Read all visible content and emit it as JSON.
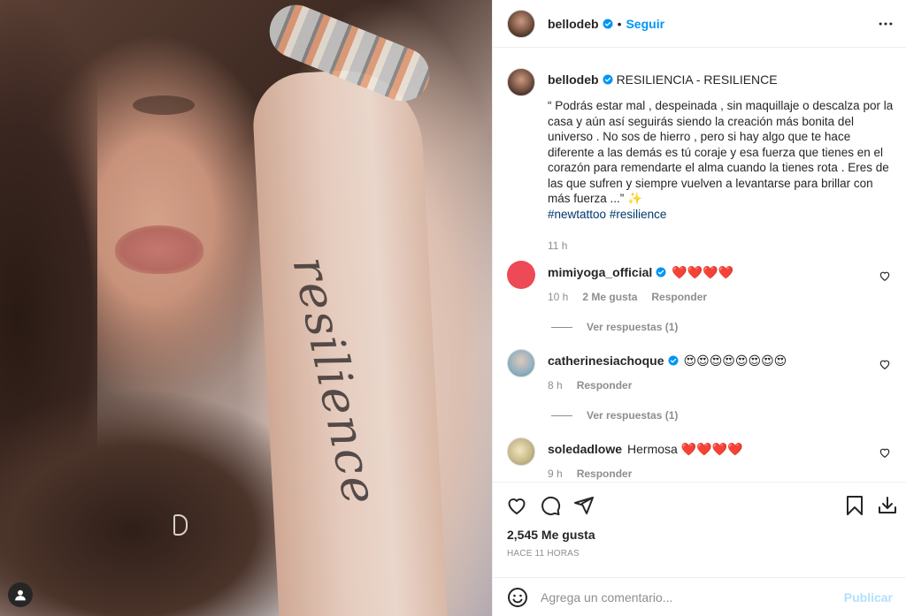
{
  "post": {
    "username": "bellodeb",
    "follow_label": "Seguir",
    "dot": "•",
    "more_icon": "more-horizontal-icon",
    "tattoo_text": "resilience",
    "pendant_letter": "D"
  },
  "caption": {
    "username": "bellodeb",
    "headline": "RESILIENCIA - RESILIENCE",
    "text": "“ Podrás estar mal , despeinada , sin maquillaje o descalza por la casa y aún así seguirás siendo la creación más bonita del universo . No sos de hierro , pero si hay algo que te hace diferente a las demás es tú coraje y esa fuerza que tienes en el corazón para remendarte el alma cuando la tienes rota . Eres de las que sufren y siempre vuelven a levantarse para brillar con más fuerza ...” ✨",
    "hashtags": [
      "#newtattoo",
      "#resilience"
    ],
    "time": "11 h"
  },
  "comments": [
    {
      "username": "mimiyoga_official",
      "text": "❤️❤️❤️❤️",
      "time": "10 h",
      "likes": "2 Me gusta",
      "reply_label": "Responder",
      "view_replies": "Ver respuestas (1)",
      "avatar_color": "#ed4956"
    },
    {
      "username": "catherinesiachoque",
      "text": "😍😍😍😍😍😍😍😍",
      "time": "8 h",
      "reply_label": "Responder",
      "view_replies": "Ver respuestas (1)",
      "avatar_color": "#9fb9c6"
    },
    {
      "username": "soledadlowe",
      "text": "Hermosa ❤️❤️❤️❤️",
      "time": "9 h",
      "reply_label": "Responder",
      "avatar_color": "#c9b98a"
    }
  ],
  "actions": {
    "like_icon": "heart-icon",
    "comment_icon": "comment-icon",
    "share_icon": "share-icon",
    "save_icon": "bookmark-icon",
    "download_icon": "download-icon"
  },
  "likes": "2,545 Me gusta",
  "posted_ago": "HACE 11 HORAS",
  "add_comment": {
    "placeholder": "Agrega un comentario...",
    "publish_label": "Publicar"
  },
  "colors": {
    "accent": "#0095f6",
    "link": "#00376b",
    "muted": "#8e8e8e",
    "publish_disabled": "#b2dffc"
  }
}
